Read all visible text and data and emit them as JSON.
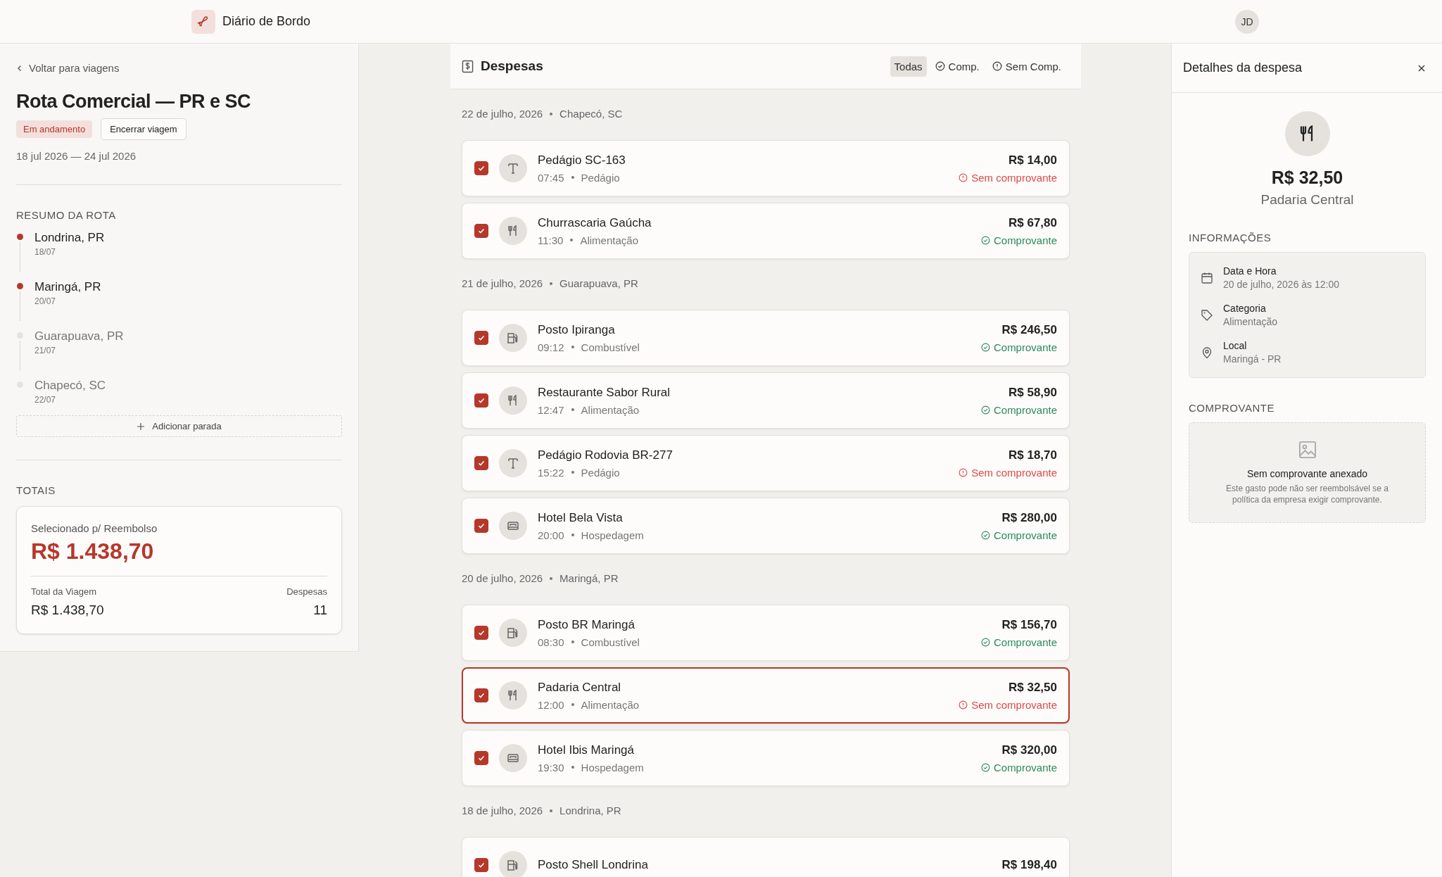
{
  "header": {
    "app_name": "Diário de Bordo",
    "avatar_initials": "JD"
  },
  "trip": {
    "back_link": "Voltar para viagens",
    "title": "Rota Comercial — PR e SC",
    "status": "Em andamento",
    "end_button": "Encerrar viagem",
    "dates": "18 jul 2026 — 24 jul 2026"
  },
  "route_summary": {
    "heading": "RESUMO DA ROTA",
    "stops": [
      {
        "city": "Londrina, PR",
        "date": "18/07",
        "reached": true
      },
      {
        "city": "Maringá, PR",
        "date": "20/07",
        "reached": true
      },
      {
        "city": "Guarapuava, PR",
        "date": "21/07",
        "reached": false
      },
      {
        "city": "Chapecó, SC",
        "date": "22/07",
        "reached": false
      }
    ],
    "add_stop": "Adicionar parada"
  },
  "totals": {
    "heading": "TOTAIS",
    "selected_label": "Selecionado p/ Reembolso",
    "selected_amount": "R$ 1.438,70",
    "trip_total_label": "Total da Viagem",
    "trip_total": "R$ 1.438,70",
    "count_label": "Despesas",
    "count": "11"
  },
  "expenses": {
    "title": "Despesas",
    "filters": [
      {
        "label": "Todas",
        "selected": true,
        "kind": "all"
      },
      {
        "label": "Comp.",
        "selected": false,
        "kind": "ok"
      },
      {
        "label": "Sem Comp.",
        "selected": false,
        "kind": "missing"
      }
    ],
    "groups": [
      {
        "date": "22 de julho, 2026",
        "place": "Chapecó, SC",
        "items": [
          {
            "name": "Pedágio SC-163",
            "time": "07:45",
            "category": "Pedágio",
            "kind": "toll",
            "amount": "R$ 14,00",
            "receipt": "Sem comprovante",
            "has_receipt": false,
            "checked": true,
            "selected": false
          },
          {
            "name": "Churrascaria Gaúcha",
            "time": "11:30",
            "category": "Alimentação",
            "kind": "food",
            "amount": "R$ 67,80",
            "receipt": "Comprovante",
            "has_receipt": true,
            "checked": true,
            "selected": false
          }
        ]
      },
      {
        "date": "21 de julho, 2026",
        "place": "Guarapuava, PR",
        "items": [
          {
            "name": "Posto Ipiranga",
            "time": "09:12",
            "category": "Combustível",
            "kind": "fuel",
            "amount": "R$ 246,50",
            "receipt": "Comprovante",
            "has_receipt": true,
            "checked": true,
            "selected": false
          },
          {
            "name": "Restaurante Sabor Rural",
            "time": "12:47",
            "category": "Alimentação",
            "kind": "food",
            "amount": "R$ 58,90",
            "receipt": "Comprovante",
            "has_receipt": true,
            "checked": true,
            "selected": false
          },
          {
            "name": "Pedágio Rodovia BR-277",
            "time": "15:22",
            "category": "Pedágio",
            "kind": "toll",
            "amount": "R$ 18,70",
            "receipt": "Sem comprovante",
            "has_receipt": false,
            "checked": true,
            "selected": false
          },
          {
            "name": "Hotel Bela Vista",
            "time": "20:00",
            "category": "Hospedagem",
            "kind": "hotel",
            "amount": "R$ 280,00",
            "receipt": "Comprovante",
            "has_receipt": true,
            "checked": true,
            "selected": false
          }
        ]
      },
      {
        "date": "20 de julho, 2026",
        "place": "Maringá, PR",
        "items": [
          {
            "name": "Posto BR Maringá",
            "time": "08:30",
            "category": "Combustível",
            "kind": "fuel",
            "amount": "R$ 156,70",
            "receipt": "Comprovante",
            "has_receipt": true,
            "checked": true,
            "selected": false
          },
          {
            "name": "Padaria Central",
            "time": "12:00",
            "category": "Alimentação",
            "kind": "food",
            "amount": "R$ 32,50",
            "receipt": "Sem comprovante",
            "has_receipt": false,
            "checked": true,
            "selected": true
          },
          {
            "name": "Hotel Ibis Maringá",
            "time": "19:30",
            "category": "Hospedagem",
            "kind": "hotel",
            "amount": "R$ 320,00",
            "receipt": "Comprovante",
            "has_receipt": true,
            "checked": true,
            "selected": false
          }
        ]
      },
      {
        "date": "18 de julho, 2026",
        "place": "Londrina, PR",
        "items": [
          {
            "name": "Posto Shell Londrina",
            "kind": "fuel",
            "amount": "R$ 198,40",
            "checked": true,
            "selected": false
          }
        ]
      }
    ]
  },
  "details": {
    "title": "Detalhes da despesa",
    "kind": "food",
    "amount": "R$ 32,50",
    "merchant": "Padaria Central",
    "info_heading": "INFORMAÇÕES",
    "info": [
      {
        "label": "Data e Hora",
        "value": "20 de julho, 2026 às 12:00",
        "kind": "date"
      },
      {
        "label": "Categoria",
        "value": "Alimentação",
        "kind": "category"
      },
      {
        "label": "Local",
        "value": "Maringá - PR",
        "kind": "place"
      }
    ],
    "receipt_heading": "COMPROVANTE",
    "receipt_title": "Sem comprovante anexado",
    "receipt_note": "Este gasto pode não ser reembolsável se a política da empresa exigir comprovante."
  }
}
